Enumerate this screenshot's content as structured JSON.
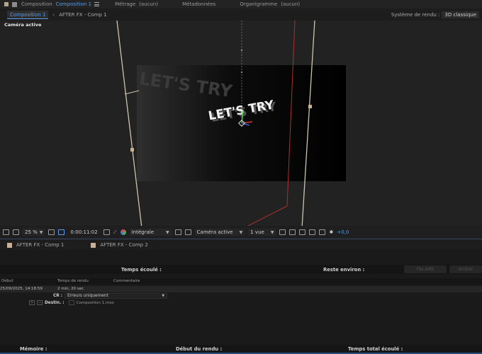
{
  "header": {
    "tab_composition_prefix": "Composition",
    "tab_composition_name": "Composition 1",
    "tab_footage": "Métrage",
    "tab_footage_value": "(aucun)",
    "tab_metadata": "Métadonnées",
    "tab_flowchart": "Organigramme",
    "tab_flowchart_value": "(aucun)"
  },
  "comp_bar": {
    "active_tab": "Composition 1",
    "other_tab": "AFTER FX - Comp 1",
    "renderer_label": "Système de rendu :",
    "renderer_value": "3D classique"
  },
  "viewer": {
    "camera_label": "Caméra active",
    "main_text": "LET'S TRY",
    "shadow_text": "LET'S TRY"
  },
  "toolbar": {
    "zoom": "25 %",
    "timecode": "0:00:11:02",
    "resolution": "Intégrale",
    "camera": "Caméra active",
    "views": "1 vue",
    "exposure": "+0,0"
  },
  "render_queue": {
    "tabs": [
      "AFTER FX - Comp 1",
      "AFTER FX - Comp 2"
    ],
    "elapsed_label": "Temps écoulé :",
    "remaining_label": "Reste environ :",
    "ame_button": "File AME",
    "stop_button": "Arrêter",
    "columns": {
      "start": "Début",
      "render_time": "Temps de rendu",
      "comment": "Commentaire"
    },
    "row": {
      "start": "25/09/2025, 14:18:59",
      "render_time": "2 min, 20 sec"
    },
    "cr_label": "CR :",
    "cr_value": "Erreurs uniquement",
    "dest_label": "Destin. :",
    "dest_value": "Composition 1.mov",
    "memory_label": "Mémoire :",
    "render_start_label": "Début du rendu :",
    "total_elapsed_label": "Temps total écoulé :"
  }
}
